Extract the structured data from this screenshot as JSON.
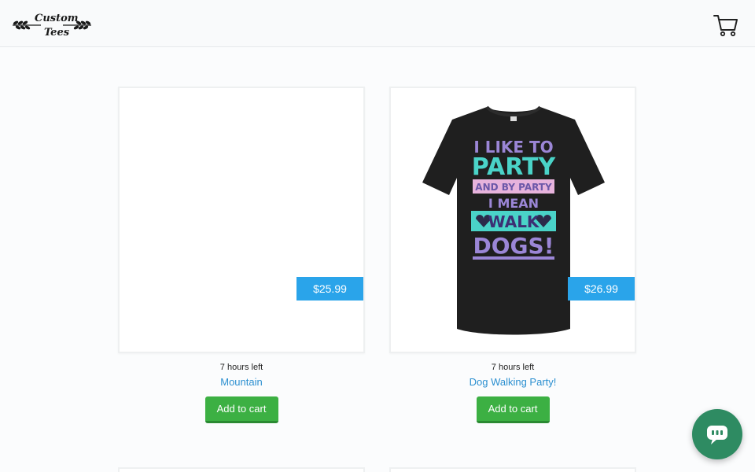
{
  "header": {
    "logo_line1": "Custom",
    "logo_line2": "Tees",
    "cart_icon": "shopping-cart-icon"
  },
  "products": [
    {
      "price": "$25.99",
      "time_left": "7 hours left",
      "title": "Mountain",
      "add_to_cart_label": "Add to cart"
    },
    {
      "price": "$26.99",
      "time_left": "7 hours left",
      "title": "Dog Walking Party!",
      "add_to_cart_label": "Add to cart",
      "design_text": {
        "line1": "I LIKE TO",
        "line2": "PARTY",
        "line3": "AND BY PARTY",
        "line4": "I MEAN",
        "line5": "WALK",
        "line6": "DOGS!"
      }
    }
  ],
  "chat": {
    "icon": "chat-bubble-icon"
  },
  "colors": {
    "price_tag": "#2aa4ea",
    "add_to_cart": "#3cb043",
    "link": "#2b8fd0",
    "chat": "#2e8b62",
    "design_teal": "#4ad3c8",
    "design_purple": "#9b86d6",
    "design_pink": "#e7b3dc"
  }
}
